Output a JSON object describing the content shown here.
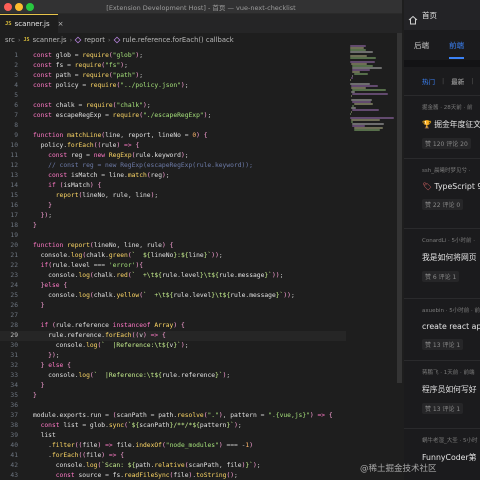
{
  "window": {
    "title": "[Extension Development Host] - 首页 — vue-next-checklist"
  },
  "tab": {
    "badge": "JS",
    "label": "scanner.js",
    "close": "×"
  },
  "breadcrumb": [
    "src",
    "JS",
    "scanner.js",
    "report",
    "rule.reference.forEach() callback"
  ],
  "code_lines": [
    {
      "n": "1",
      "html": "<span class='kw'>const</span> <span class='var'>glob</span> <span class='pun'>=</span> <span class='fn'>require</span><span class='br'>(</span><span class='str'>\"glob\"</span><span class='br'>)</span><span class='pun'>;</span>"
    },
    {
      "n": "2",
      "html": "<span class='kw'>const</span> <span class='var'>fs</span> <span class='pun'>=</span> <span class='fn'>require</span><span class='br'>(</span><span class='str'>\"fs\"</span><span class='br'>)</span><span class='pun'>;</span>"
    },
    {
      "n": "3",
      "html": "<span class='kw'>const</span> <span class='var'>path</span> <span class='pun'>=</span> <span class='fn'>require</span><span class='br'>(</span><span class='str'>\"path\"</span><span class='br'>)</span><span class='pun'>;</span>"
    },
    {
      "n": "4",
      "html": "<span class='kw'>const</span> <span class='var'>policy</span> <span class='pun'>=</span> <span class='fn'>require</span><span class='br'>(</span><span class='str'>\"../policy.json\"</span><span class='br'>)</span><span class='pun'>;</span>"
    },
    {
      "n": "5",
      "html": ""
    },
    {
      "n": "6",
      "html": "<span class='kw'>const</span> <span class='var'>chalk</span> <span class='pun'>=</span> <span class='fn'>require</span><span class='br'>(</span><span class='str'>\"chalk\"</span><span class='br'>)</span><span class='pun'>;</span>"
    },
    {
      "n": "7",
      "html": "<span class='kw'>const</span> <span class='var'>escapeRegExp</span> <span class='pun'>=</span> <span class='fn'>require</span><span class='br'>(</span><span class='str'>\"./escapeRegExp\"</span><span class='br'>)</span><span class='pun'>;</span>"
    },
    {
      "n": "8",
      "html": ""
    },
    {
      "n": "9",
      "html": "<span class='kw'>function</span> <span class='fn'>matchLine</span><span class='br'>(</span><span class='var'>line</span><span class='pun'>,</span> <span class='var'>report</span><span class='pun'>,</span> <span class='var'>lineNo</span> <span class='pun'>=</span> <span class='num'>0</span><span class='br'>)</span> <span class='br'>{</span>"
    },
    {
      "n": "10",
      "html": "  <span class='var'>policy</span><span class='pun'>.</span><span class='fn'>forEach</span><span class='br'>((</span><span class='var'>rule</span><span class='br'>)</span> <span class='kw'>=&gt;</span> <span class='br'>{</span>"
    },
    {
      "n": "11",
      "html": "    <span class='kw'>const</span> <span class='var'>reg</span> <span class='pun'>=</span> <span class='kw'>new</span> <span class='fn'>RegExp</span><span class='br'>(</span><span class='var'>rule</span><span class='pun'>.</span><span class='prop'>keyword</span><span class='br'>)</span><span class='pun'>;</span>"
    },
    {
      "n": "12",
      "html": "    <span class='cmt'>// const reg = new RegExp(escapeRegExp(rule.keyword));</span>"
    },
    {
      "n": "13",
      "html": "    <span class='kw'>const</span> <span class='var'>isMatch</span> <span class='pun'>=</span> <span class='var'>line</span><span class='pun'>.</span><span class='fn'>match</span><span class='br'>(</span><span class='var'>reg</span><span class='br'>)</span><span class='pun'>;</span>"
    },
    {
      "n": "14",
      "html": "    <span class='kw'>if</span> <span class='br'>(</span><span class='var'>isMatch</span><span class='br'>)</span> <span class='br'>{</span>"
    },
    {
      "n": "15",
      "html": "      <span class='fn'>report</span><span class='br'>(</span><span class='var'>lineNo</span><span class='pun'>,</span> <span class='var'>rule</span><span class='pun'>,</span> <span class='var'>line</span><span class='br'>)</span><span class='pun'>;</span>"
    },
    {
      "n": "16",
      "html": "    <span class='br'>}</span>"
    },
    {
      "n": "17",
      "html": "  <span class='br'>})</span><span class='pun'>;</span>"
    },
    {
      "n": "18",
      "html": "<span class='br'>}</span>"
    },
    {
      "n": "19",
      "html": ""
    },
    {
      "n": "20",
      "html": "<span class='kw'>function</span> <span class='fn'>report</span><span class='br'>(</span><span class='var'>lineNo</span><span class='pun'>,</span> <span class='var'>line</span><span class='pun'>,</span> <span class='var'>rule</span><span class='br'>)</span> <span class='br'>{</span>"
    },
    {
      "n": "21",
      "html": "  <span class='var'>console</span><span class='pun'>.</span><span class='fn'>log</span><span class='br'>(</span><span class='var'>chalk</span><span class='pun'>.</span><span class='fn'>green</span><span class='br'>(</span><span class='tpl'>`  ${</span><span class='var'>lineNo</span><span class='tpl'>}:${</span><span class='var'>line</span><span class='tpl'>}`</span><span class='br'>))</span><span class='pun'>;</span>"
    },
    {
      "n": "22",
      "html": "  <span class='kw'>if</span><span class='br'>(</span><span class='var'>rule</span><span class='pun'>.</span><span class='prop'>level</span> <span class='pun'>===</span> <span class='str'>'error'</span><span class='br'>)</span><span class='br'>{</span>"
    },
    {
      "n": "23",
      "html": "    <span class='var'>console</span><span class='pun'>.</span><span class='fn'>log</span><span class='br'>(</span><span class='var'>chalk</span><span class='pun'>.</span><span class='fn'>red</span><span class='br'>(</span><span class='tpl'>`  +\\t${</span><span class='var'>rule</span><span class='pun'>.</span><span class='prop'>level</span><span class='tpl'>}\\t${</span><span class='var'>rule</span><span class='pun'>.</span><span class='prop'>message</span><span class='tpl'>}`</span><span class='br'>))</span><span class='pun'>;</span>"
    },
    {
      "n": "24",
      "html": "  <span class='br'>}</span><span class='kw'>else</span> <span class='br'>{</span>"
    },
    {
      "n": "25",
      "html": "    <span class='var'>console</span><span class='pun'>.</span><span class='fn'>log</span><span class='br'>(</span><span class='var'>chalk</span><span class='pun'>.</span><span class='fn'>yellow</span><span class='br'>(</span><span class='tpl'>`  +\\t${</span><span class='var'>rule</span><span class='pun'>.</span><span class='prop'>level</span><span class='tpl'>}\\t${</span><span class='var'>rule</span><span class='pun'>.</span><span class='prop'>message</span><span class='tpl'>}`</span><span class='br'>))</span><span class='pun'>;</span>"
    },
    {
      "n": "26",
      "html": "  <span class='br'>}</span>"
    },
    {
      "n": "27",
      "html": ""
    },
    {
      "n": "28",
      "html": "  <span class='kw'>if</span> <span class='br'>(</span><span class='var'>rule</span><span class='pun'>.</span><span class='prop'>reference</span> <span class='kw'>instanceof</span> <span class='fn'>Array</span><span class='br'>)</span> <span class='br'>{</span>"
    },
    {
      "n": "29",
      "html": "    <span class='var'>rule</span><span class='pun'>.</span><span class='prop'>reference</span><span class='pun'>.</span><span class='fn'>forEach</span><span class='br'>((</span><span class='var'>v</span><span class='br'>)</span> <span class='kw'>=&gt;</span> <span class='br'>{</span>"
    },
    {
      "n": "30",
      "html": "      <span class='var'>console</span><span class='pun'>.</span><span class='fn'>log</span><span class='br'>(</span><span class='tpl'>`  |Reference:\\t${</span><span class='var'>v</span><span class='tpl'>}`</span><span class='br'>)</span><span class='pun'>;</span>"
    },
    {
      "n": "31",
      "html": "    <span class='br'>})</span><span class='pun'>;</span>"
    },
    {
      "n": "32",
      "html": "  <span class='br'>}</span> <span class='kw'>else</span> <span class='br'>{</span>"
    },
    {
      "n": "33",
      "html": "    <span class='var'>console</span><span class='pun'>.</span><span class='fn'>log</span><span class='br'>(</span><span class='tpl'>`  |Reference:\\t${</span><span class='var'>rule</span><span class='pun'>.</span><span class='prop'>reference</span><span class='tpl'>}`</span><span class='br'>)</span><span class='pun'>;</span>"
    },
    {
      "n": "34",
      "html": "  <span class='br'>}</span>"
    },
    {
      "n": "35",
      "html": "<span class='br'>}</span>"
    },
    {
      "n": "36",
      "html": ""
    },
    {
      "n": "37",
      "html": "<span class='var'>module</span><span class='pun'>.</span><span class='prop'>exports</span><span class='pun'>.</span><span class='prop'>run</span> <span class='pun'>=</span> <span class='br'>(</span><span class='var'>scanPath</span> <span class='pun'>=</span> <span class='var'>path</span><span class='pun'>.</span><span class='fn'>resolve</span><span class='br'>(</span><span class='str'>\".\"</span><span class='br'>)</span><span class='pun'>,</span> <span class='var'>pattern</span> <span class='pun'>=</span> <span class='str'>\".{vue,js}\"</span><span class='br'>)</span> <span class='kw'>=&gt;</span> <span class='br'>{</span>"
    },
    {
      "n": "38",
      "html": "  <span class='kw'>const</span> <span class='var'>list</span> <span class='pun'>=</span> <span class='var'>glob</span><span class='pun'>.</span><span class='fn'>sync</span><span class='br'>(</span><span class='tpl'>`${</span><span class='var'>scanPath</span><span class='tpl'>}/**/*${</span><span class='var'>pattern</span><span class='tpl'>}`</span><span class='br'>)</span><span class='pun'>;</span>"
    },
    {
      "n": "39",
      "html": "  <span class='var'>list</span>"
    },
    {
      "n": "40",
      "html": "    <span class='pun'>.</span><span class='fn'>filter</span><span class='br'>((</span><span class='var'>file</span><span class='br'>)</span> <span class='kw'>=&gt;</span> <span class='var'>file</span><span class='pun'>.</span><span class='fn'>indexOf</span><span class='br'>(</span><span class='str'>\"node_modules\"</span><span class='br'>)</span> <span class='pun'>===</span> <span class='pun'>-</span><span class='num'>1</span><span class='br'>)</span>"
    },
    {
      "n": "41",
      "html": "    <span class='pun'>.</span><span class='fn'>forEach</span><span class='br'>((</span><span class='var'>file</span><span class='br'>)</span> <span class='kw'>=&gt;</span> <span class='br'>{</span>"
    },
    {
      "n": "42",
      "html": "      <span class='var'>console</span><span class='pun'>.</span><span class='fn'>log</span><span class='br'>(</span><span class='tpl'>`Scan: ${</span><span class='var'>path</span><span class='pun'>.</span><span class='fn'>relative</span><span class='br'>(</span><span class='var'>scanPath</span><span class='pun'>,</span> <span class='var'>file</span><span class='br'>)</span><span class='tpl'>}`</span><span class='br'>)</span><span class='pun'>;</span>"
    },
    {
      "n": "43",
      "html": "      <span class='kw'>const</span> <span class='var'>source</span> <span class='pun'>=</span> <span class='var'>fs</span><span class='pun'>.</span><span class='fn'>readFileSync</span><span class='br'>(</span><span class='var'>file</span><span class='br'>)</span><span class='pun'>.</span><span class='fn'>toString</span><span class='br'>()</span><span class='pun'>;</span>"
    }
  ],
  "active_line": "29",
  "panel": {
    "title": "首页",
    "tabs": [
      "后端",
      "前端"
    ],
    "filters": [
      "热门",
      "最新"
    ],
    "filter_sep": "|",
    "feed": [
      {
        "meta": "掘金酱 · 28天前 · 前",
        "title": "掘金年度征文",
        "stats": "赞 120  评论 20",
        "icon": "🏆"
      },
      {
        "meta": "ssh_晨曦时梦见兮 ·",
        "title": "TypeScript 9",
        "stats": "赞 22  评论 0",
        "icon": "🏷"
      },
      {
        "meta": "ConardLi · 5小时前 ·",
        "title": "我是如何将网页",
        "stats": "赞 6  评论 1",
        "icon": ""
      },
      {
        "meta": "axuebin · 5小时前 · 前",
        "title": "create react ap",
        "stats": "赞 13  评论 1",
        "icon": ""
      },
      {
        "meta": "蒋鹏飞 · 1天前 · 前端",
        "title": "程序员如何写好",
        "stats": "赞 13  评论 1",
        "icon": ""
      },
      {
        "meta": "蜗牛老湿_大圣 · 5小时",
        "title": "FunnyCoder第",
        "stats": "",
        "icon": ""
      }
    ]
  },
  "watermark": "@稀土掘金技术社区",
  "colors": {
    "accent": "#3b82f6",
    "tab_border": "#e8c44a"
  }
}
